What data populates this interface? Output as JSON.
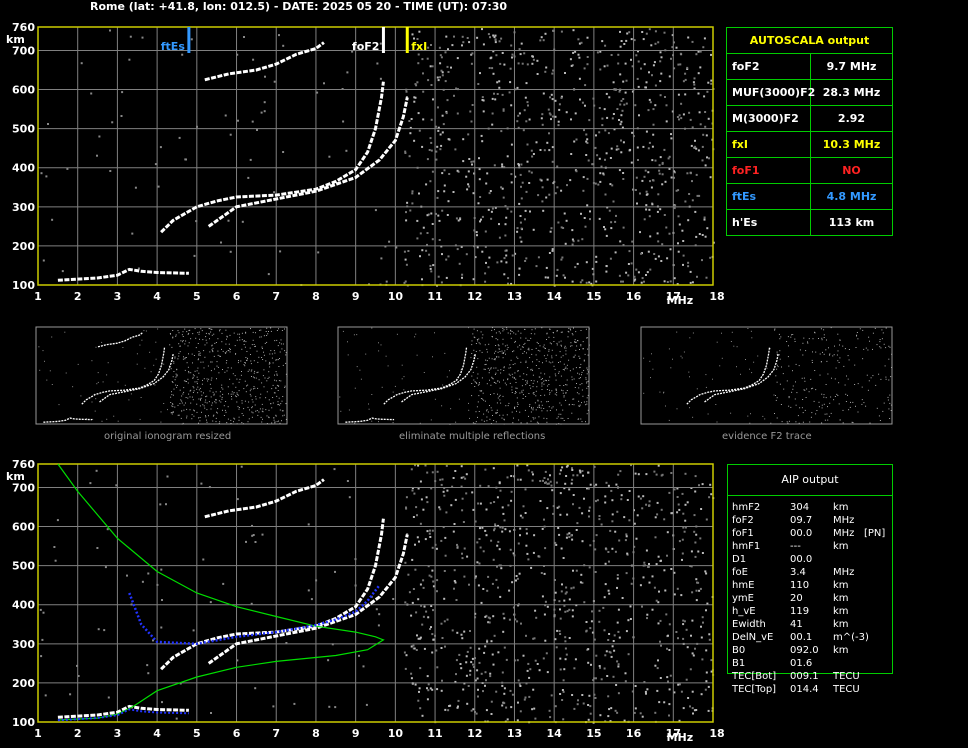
{
  "header": "Rome (lat: +41.8, lon: 012.5) - DATE: 2025 05 20 - TIME (UT): 07:30",
  "colors": {
    "fof2": "#ffffff",
    "fxi": "#ffff00",
    "ftes": "#3399ff",
    "fof1": "#ff2222",
    "grid": "#808080",
    "frame": "#cccc00",
    "panel": "#00cc00",
    "profile": "#00dd00",
    "trace": "#2233ff"
  },
  "axes": {
    "x_ticks": [
      1,
      2,
      3,
      4,
      5,
      6,
      7,
      8,
      9,
      10,
      11,
      12,
      13,
      14,
      15,
      16,
      17,
      18
    ],
    "x_unit": "MHz",
    "y_ticks": [
      100,
      200,
      300,
      400,
      500,
      600,
      700
    ],
    "y_top": 760,
    "y_unit": "km",
    "xlim": [
      1,
      18
    ],
    "ylim": [
      100,
      760
    ]
  },
  "markers": [
    {
      "label": "ftEs",
      "freq": 4.8,
      "color": "#3399ff"
    },
    {
      "label": "foF2",
      "freq": 9.7,
      "color": "#ffffff"
    },
    {
      "label": "fxI",
      "freq": 10.3,
      "color": "#ffff00"
    }
  ],
  "autoscala": {
    "title": "AUTOSCALA output",
    "rows": [
      {
        "label": "foF2",
        "value": "9.7 MHz",
        "color": "#ffffff"
      },
      {
        "label": "MUF(3000)F2",
        "value": "28.3 MHz",
        "color": "#ffffff"
      },
      {
        "label": "M(3000)F2",
        "value": "2.92",
        "color": "#ffffff"
      },
      {
        "label": "fxI",
        "value": "10.3 MHz",
        "color": "#ffff00"
      },
      {
        "label": "foF1",
        "value": "NO",
        "color": "#ff2222"
      },
      {
        "label": "ftEs",
        "value": "4.8 MHz",
        "color": "#3399ff"
      },
      {
        "label": "h'Es",
        "value": "113     km",
        "color": "#ffffff"
      }
    ]
  },
  "thumbnails": [
    {
      "caption": "original ionogram resized"
    },
    {
      "caption": "eliminate multiple reflections"
    },
    {
      "caption": "evidence F2 trace"
    }
  ],
  "aip": {
    "title": "AIP output",
    "rows": [
      {
        "k": "hmF2",
        "v": "304",
        "u": "km",
        "x": ""
      },
      {
        "k": "foF2",
        "v": "09.7",
        "u": "MHz",
        "x": ""
      },
      {
        "k": "foF1",
        "v": "00.0",
        "u": "MHz",
        "x": "[PN]"
      },
      {
        "k": "hmF1",
        "v": "---",
        "u": "km",
        "x": ""
      },
      {
        "k": "D1",
        "v": "00.0",
        "u": "",
        "x": ""
      },
      {
        "k": "foE",
        "v": "3.4",
        "u": "MHz",
        "x": ""
      },
      {
        "k": "hmE",
        "v": "110",
        "u": "km",
        "x": ""
      },
      {
        "k": "ymE",
        "v": "20",
        "u": "km",
        "x": ""
      },
      {
        "k": "h_vE",
        "v": "119",
        "u": "km",
        "x": ""
      },
      {
        "k": "Ewidth",
        "v": "41",
        "u": "km",
        "x": ""
      },
      {
        "k": "DelN_vE",
        "v": "00.1",
        "u": "m^(-3)",
        "x": ""
      },
      {
        "k": "B0",
        "v": "092.0",
        "u": "km",
        "x": ""
      },
      {
        "k": "B1",
        "v": "01.6",
        "u": "",
        "x": ""
      },
      {
        "k": "TEC[Bot]",
        "v": "009.1",
        "u": "TECU",
        "x": ""
      },
      {
        "k": "TEC[Top]",
        "v": "014.4",
        "u": "TECU",
        "x": ""
      }
    ]
  },
  "chart_data": {
    "type": "scatter",
    "title": "Rome (lat: +41.8, lon: 012.5) - DATE: 2025 05 20 - TIME (UT): 07:30",
    "xlabel": "MHz",
    "ylabel": "km",
    "xlim": [
      1,
      18
    ],
    "ylim": [
      100,
      760
    ],
    "grid": true,
    "series": [
      {
        "name": "E / Es trace",
        "points": [
          [
            1.5,
            112
          ],
          [
            2.0,
            115
          ],
          [
            2.5,
            118
          ],
          [
            3.0,
            125
          ],
          [
            3.3,
            140
          ],
          [
            3.6,
            135
          ],
          [
            4.0,
            132
          ],
          [
            4.8,
            130
          ]
        ]
      },
      {
        "name": "F2 trace (O)",
        "points": [
          [
            4.1,
            235
          ],
          [
            4.4,
            265
          ],
          [
            5.0,
            300
          ],
          [
            5.5,
            315
          ],
          [
            6.0,
            325
          ],
          [
            7.0,
            330
          ],
          [
            8.0,
            345
          ],
          [
            8.5,
            365
          ],
          [
            9.0,
            395
          ],
          [
            9.3,
            440
          ],
          [
            9.5,
            500
          ],
          [
            9.65,
            580
          ],
          [
            9.7,
            620
          ]
        ]
      },
      {
        "name": "F2 trace (X)",
        "points": [
          [
            5.3,
            250
          ],
          [
            6.0,
            300
          ],
          [
            7.0,
            320
          ],
          [
            8.0,
            340
          ],
          [
            9.0,
            375
          ],
          [
            9.6,
            420
          ],
          [
            10.0,
            470
          ],
          [
            10.2,
            530
          ],
          [
            10.3,
            580
          ]
        ]
      },
      {
        "name": "second hop",
        "points": [
          [
            5.2,
            625
          ],
          [
            5.8,
            640
          ],
          [
            6.5,
            650
          ],
          [
            7.0,
            665
          ],
          [
            7.5,
            690
          ],
          [
            8.0,
            705
          ],
          [
            8.2,
            720
          ]
        ]
      },
      {
        "name": "AIP electron density profile",
        "points": [
          [
            1.5,
            760
          ],
          [
            2.0,
            690
          ],
          [
            3.0,
            570
          ],
          [
            4.0,
            485
          ],
          [
            5.0,
            430
          ],
          [
            6.0,
            395
          ],
          [
            7.0,
            370
          ],
          [
            8.0,
            345
          ],
          [
            9.0,
            330
          ],
          [
            9.5,
            318
          ],
          [
            9.7,
            310
          ],
          [
            9.3,
            285
          ],
          [
            8.5,
            270
          ],
          [
            7.0,
            255
          ],
          [
            6.0,
            240
          ],
          [
            5.0,
            215
          ],
          [
            4.0,
            180
          ],
          [
            3.4,
            140
          ],
          [
            3.0,
            120
          ],
          [
            2.5,
            110
          ],
          [
            1.5,
            105
          ]
        ]
      },
      {
        "name": "AIP fitted trace",
        "points": [
          [
            3.3,
            430
          ],
          [
            3.6,
            350
          ],
          [
            4.0,
            305
          ],
          [
            5.0,
            300
          ],
          [
            6.0,
            318
          ],
          [
            7.0,
            330
          ],
          [
            8.0,
            348
          ],
          [
            8.5,
            362
          ],
          [
            9.0,
            382
          ],
          [
            9.3,
            410
          ],
          [
            9.6,
            450
          ]
        ]
      }
    ]
  }
}
